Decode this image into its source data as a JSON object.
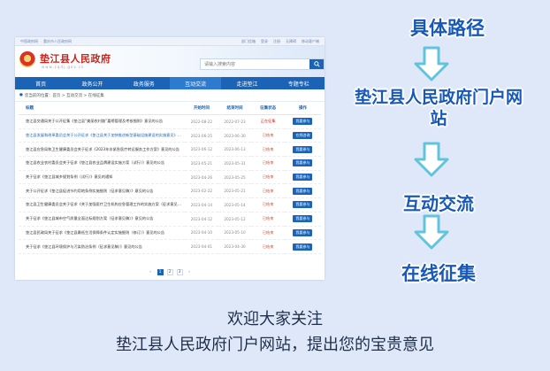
{
  "browser_shot": {
    "topbar_left": [
      "中国政府网",
      "重庆市人民政府网"
    ],
    "topbar_right": [
      "部门信箱",
      "登录",
      "注册",
      "无障碍",
      "移动客户端"
    ],
    "site_title": "垫江县人民政府",
    "site_url": "www.cqdj.gov.cn",
    "search_placeholder": "请输入搜索内容",
    "nav": [
      "首页",
      "政务公开",
      "政务服务",
      "互动交流",
      "走进垫江",
      "专题专栏"
    ],
    "nav_active": 3,
    "breadcrumb": "您当前的位置：首页 > 互动交流 > 在线征集",
    "columns": [
      "标题",
      "开始时间",
      "结束时间",
      "征集状态",
      "操作"
    ],
    "rows": [
      {
        "title": "垫江县交通局关于公开征集《垫江县“美丽农村路”嘉榜管理及考核细则》意见的公告",
        "start": "2022-08-22",
        "end": "2022-07-23",
        "status": "正在征集",
        "action": "我要参与"
      },
      {
        "title": "垫江县发展和改革委员会关于公开征求《垫江县关于加快推进新型基础设施建设的实施意见》意见的公告",
        "start": "2023-06-25",
        "end": "2023-06-30",
        "status": "已结束",
        "action": "在线咨询"
      },
      {
        "title": "垫江县应急局和卫生健康委员会关于征求《2023年非紧急医疗转运服务工作方案》意见的公告",
        "start": "2023-06-12",
        "end": "2023-06-13",
        "status": "已结束",
        "action": "我要参与"
      },
      {
        "title": "垫江县农业农村委员会关于征求《垫江县农业品牌建设实施方案（试行）》意见的公告",
        "start": "2023-05-21",
        "end": "2023-05-31",
        "status": "已结束",
        "action": "我要参与"
      },
      {
        "title": "关于征求《垫江县城乡规划条例（试行）》意见的通知",
        "start": "2023-04-26",
        "end": "2023-05-25",
        "status": "已结束",
        "action": "我要参与"
      },
      {
        "title": "关于公开征求《垫江县促进节约用地条例实施细则（征求意见稿）》意见的公告",
        "start": "2023-02-22",
        "end": "2023-05-21",
        "status": "已结束",
        "action": "我要参与"
      },
      {
        "title": "垫江县卫生健康委员会关于征求《关于加强医疗卫生机构应急管理工作的实施方案（征求意见稿）》意见的公告",
        "start": "2023-04-14",
        "end": "2023-05-14",
        "status": "已结束",
        "action": "我要参与"
      },
      {
        "title": "关于征求《垫江县城市空气质量全面达标规划方案（征求意见稿）》意见的公告",
        "start": "2023-04-12",
        "end": "2023-05-12",
        "status": "已结束",
        "action": "我要参与"
      },
      {
        "title": "垫江县民政局关于征求《垫江县最低生活保障条件认定实施细则（修订）》意见的公告",
        "start": "2023-04-10",
        "end": "2023-05-10",
        "status": "已结束",
        "action": "我要参与"
      },
      {
        "title": "关于征求《垫江县环境保护与污染防治条例（征求意见稿）》意见的公告",
        "start": "2023-04-01",
        "end": "2023-04-30",
        "status": "已结束",
        "action": "我要参与"
      }
    ],
    "pagination": [
      "‹",
      "1",
      "2",
      "3",
      "›"
    ],
    "page_active": 1
  },
  "steps": [
    "具体路径",
    "垫江县人民政府门户网站",
    "互动交流",
    "在线征集"
  ],
  "footer": {
    "line1": "欢迎大家关注",
    "line2": "垫江县人民政府门户网站，提出您的宝贵意见"
  },
  "colors": {
    "accent": "#1758b8",
    "arrow": "#62c3dc",
    "brand_red": "#c8251d",
    "nav_blue": "#1a63b6"
  }
}
